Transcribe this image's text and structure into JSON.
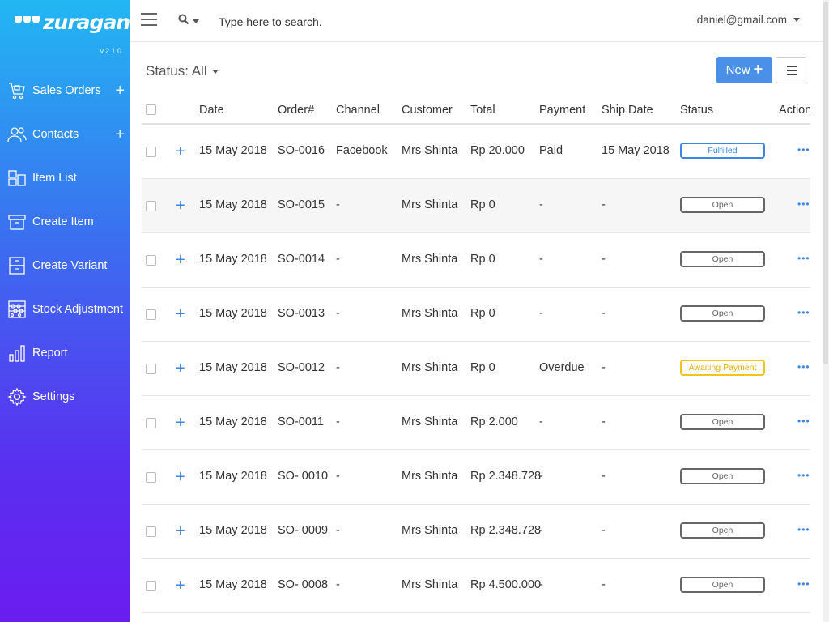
{
  "brand": {
    "name": "zuragan",
    "version": "v.2.1.0"
  },
  "sidebar": {
    "items": [
      {
        "label": "Sales Orders",
        "icon": "cart-icon",
        "has_add": true
      },
      {
        "label": "Contacts",
        "icon": "contacts-icon",
        "has_add": true
      },
      {
        "label": "Item List",
        "icon": "boxes-icon",
        "has_add": false
      },
      {
        "label": "Create Item",
        "icon": "box-icon",
        "has_add": false
      },
      {
        "label": "Create Variant",
        "icon": "variant-icon",
        "has_add": false
      },
      {
        "label": "Stock Adjustment",
        "icon": "abacus-icon",
        "has_add": false
      },
      {
        "label": "Report",
        "icon": "bar-chart-icon",
        "has_add": false
      },
      {
        "label": "Settings",
        "icon": "gear-icon",
        "has_add": false
      }
    ],
    "add_symbol": "+"
  },
  "topbar": {
    "search_placeholder": "Type here to search.",
    "user_email": "daniel@gmail.com"
  },
  "toolbar": {
    "status_filter": "Status: All",
    "new_label": "New",
    "new_symbol": "+"
  },
  "table": {
    "headers": {
      "date": "Date",
      "order": "Order#",
      "channel": "Channel",
      "customer": "Customer",
      "total": "Total",
      "payment": "Payment",
      "ship_date": "Ship Date",
      "status": "Status",
      "action": "Action"
    },
    "rows": [
      {
        "date": "15 May 2018",
        "order": "SO-0016",
        "channel": "Facebook",
        "customer": "Mrs Shinta",
        "total": "Rp 20.000",
        "payment": "Paid",
        "ship_date": "15 May 2018",
        "status": "Fulfilled",
        "status_type": "fulfilled"
      },
      {
        "date": "15 May 2018",
        "order": "SO-0015",
        "channel": "-",
        "customer": "Mrs Shinta",
        "total": "Rp 0",
        "payment": "-",
        "ship_date": "-",
        "status": "Open",
        "status_type": "open"
      },
      {
        "date": "15 May 2018",
        "order": "SO-0014",
        "channel": "-",
        "customer": "Mrs Shinta",
        "total": "Rp 0",
        "payment": "-",
        "ship_date": "-",
        "status": "Open",
        "status_type": "open"
      },
      {
        "date": "15 May 2018",
        "order": "SO-0013",
        "channel": "-",
        "customer": "Mrs Shinta",
        "total": "Rp 0",
        "payment": "-",
        "ship_date": "-",
        "status": "Open",
        "status_type": "open"
      },
      {
        "date": "15 May 2018",
        "order": "SO-0012",
        "channel": "-",
        "customer": "Mrs Shinta",
        "total": "Rp 0",
        "payment": "Overdue",
        "ship_date": "-",
        "status": "Awaiting Payment",
        "status_type": "awaiting"
      },
      {
        "date": "15 May 2018",
        "order": "SO-0011",
        "channel": "-",
        "customer": "Mrs Shinta",
        "total": "Rp 2.000",
        "payment": "-",
        "ship_date": "-",
        "status": "Open",
        "status_type": "open"
      },
      {
        "date": "15 May 2018",
        "order": "SO- 0010",
        "channel": "-",
        "customer": "Mrs Shinta",
        "total": "Rp 2.348.728",
        "payment": "-",
        "ship_date": "-",
        "status": "Open",
        "status_type": "open"
      },
      {
        "date": "15 May 2018",
        "order": "SO- 0009",
        "channel": "-",
        "customer": "Mrs Shinta",
        "total": "Rp 2.348.728",
        "payment": "-",
        "ship_date": "-",
        "status": "Open",
        "status_type": "open"
      },
      {
        "date": "15 May 2018",
        "order": "SO- 0008",
        "channel": "-",
        "customer": "Mrs Shinta",
        "total": "Rp 4.500.000",
        "payment": "-",
        "ship_date": "-",
        "status": "Open",
        "status_type": "open"
      }
    ],
    "expand_symbol": "+",
    "action_symbol": "•••"
  },
  "colors": {
    "sidebar_top": "#22b7f2",
    "sidebar_bottom": "#6a1df0",
    "accent_blue": "#4a8fe8",
    "fulfilled": "#3a86e0",
    "awaiting": "#f0c419",
    "open": "#666666"
  }
}
